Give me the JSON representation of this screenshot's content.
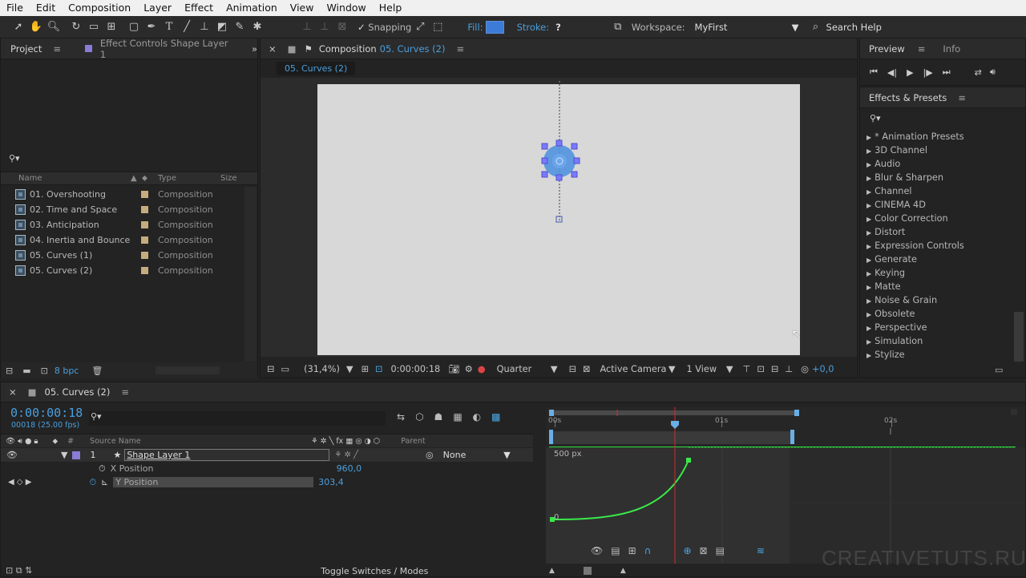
{
  "menu": [
    "File",
    "Edit",
    "Composition",
    "Layer",
    "Effect",
    "Animation",
    "View",
    "Window",
    "Help"
  ],
  "toolbar": {
    "snapping_label": "Snapping",
    "fill_label": "Fill:",
    "stroke_label": "Stroke:",
    "stroke_value": "?",
    "workspace_label": "Workspace:",
    "workspace_value": "MyFirst",
    "search_help": "Search Help",
    "fill_color": "#3d7bd9"
  },
  "project_panel": {
    "tab_project": "Project",
    "tab_effect_controls": "Effect Controls Shape Layer 1",
    "columns": {
      "name": "Name",
      "type": "Type",
      "size": "Size"
    },
    "items": [
      {
        "name": "01. Overshooting",
        "type": "Composition"
      },
      {
        "name": "02. Time and Space",
        "type": "Composition"
      },
      {
        "name": "03. Anticipation",
        "type": "Composition"
      },
      {
        "name": "04. Inertia and Bounce",
        "type": "Composition"
      },
      {
        "name": "05. Curves (1)",
        "type": "Composition"
      },
      {
        "name": "05. Curves (2)",
        "type": "Composition"
      }
    ],
    "bpc": "8 bpc"
  },
  "composition_panel": {
    "tab_label": "Composition",
    "tab_comp": "05. Curves (2)",
    "subtab": "05. Curves (2)",
    "zoom": "(31,4%)",
    "timecode": "0:00:00:18",
    "resolution": "Quarter",
    "camera": "Active Camera",
    "views": "1 View",
    "exposure": "+0,0"
  },
  "preview_panel": {
    "tab_preview": "Preview",
    "tab_info": "Info"
  },
  "effects_panel": {
    "title": "Effects & Presets",
    "items": [
      "* Animation Presets",
      "3D Channel",
      "Audio",
      "Blur & Sharpen",
      "Channel",
      "CINEMA 4D",
      "Color Correction",
      "Distort",
      "Expression Controls",
      "Generate",
      "Keying",
      "Matte",
      "Noise & Grain",
      "Obsolete",
      "Perspective",
      "Simulation",
      "Stylize"
    ]
  },
  "timeline": {
    "tab": "05. Curves (2)",
    "timecode": "0:00:00:18",
    "frame_info": "00018 (25.00 fps)",
    "col_source": "Source Name",
    "col_parent": "Parent",
    "layer_num": "1",
    "layer_name": "Shape Layer 1",
    "parent_value": "None",
    "props": [
      {
        "name": "X Position",
        "value": "960,0"
      },
      {
        "name": "Y Position",
        "value": "303,4"
      }
    ],
    "ruler": [
      "00s",
      "01s",
      "02s"
    ],
    "graph_top_label": "500 px",
    "graph_zero_label": "0",
    "toggle_label": "Toggle Switches / Modes"
  },
  "watermark": "CREATIVETUTS.RU"
}
